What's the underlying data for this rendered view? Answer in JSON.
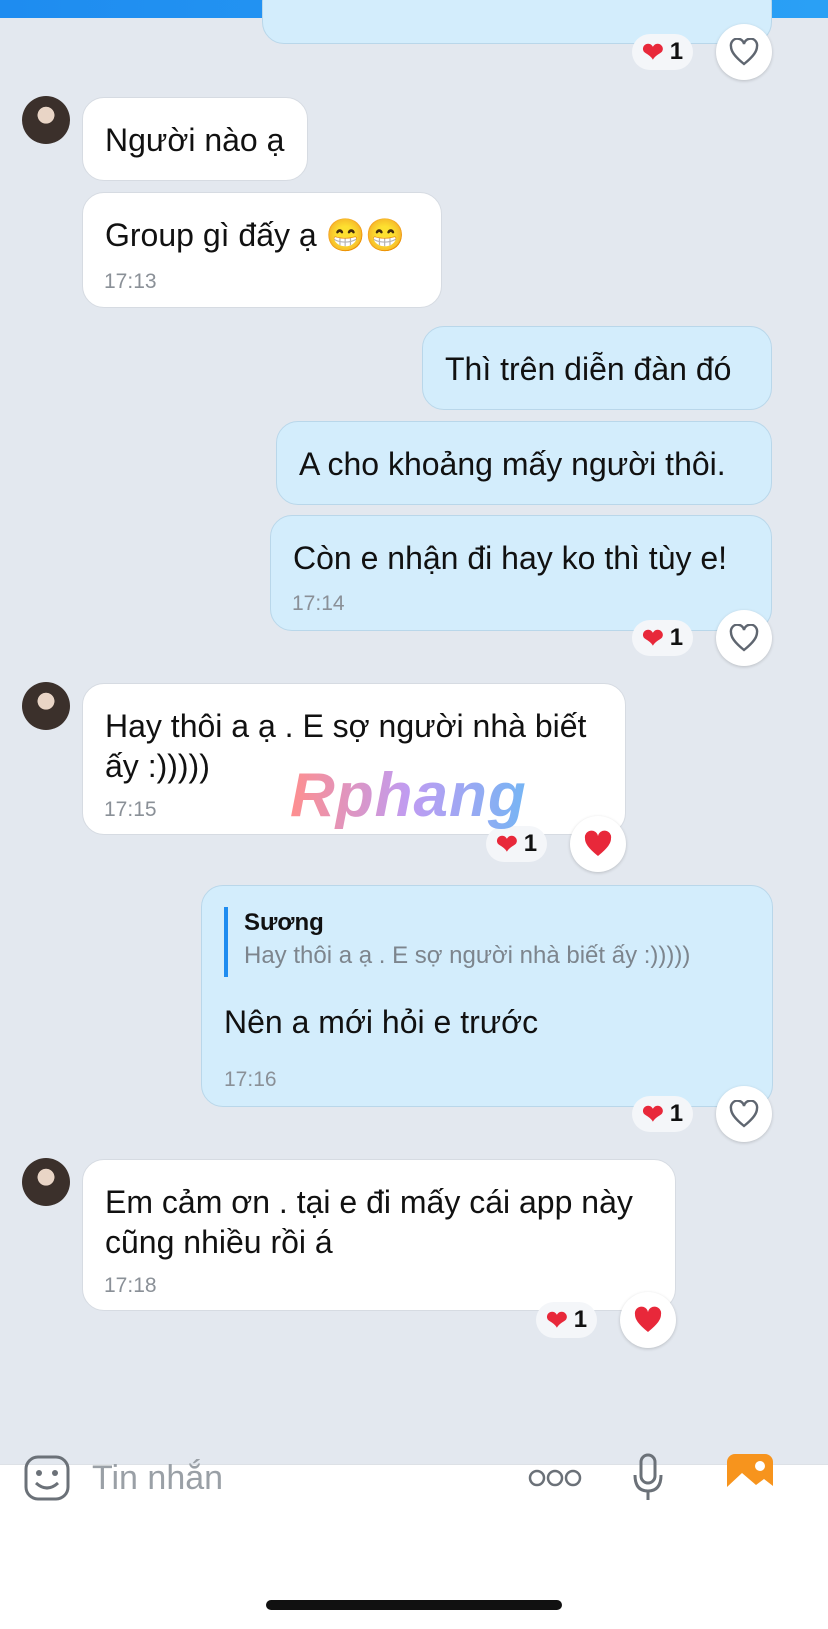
{
  "colors": {
    "background": "#e3e8ef",
    "incoming_bubble": "#ffffff",
    "outgoing_bubble": "#d3edfc",
    "accent": "#1e8cf0",
    "heart": "#e8283a",
    "image_button": "#f7941d"
  },
  "messages": [
    {
      "id": "m1",
      "side": "incoming",
      "text": "Người nào ạ"
    },
    {
      "id": "m2",
      "side": "incoming",
      "text": "Group gì đấy ạ 😁😁",
      "time": "17:13"
    },
    {
      "id": "m3",
      "side": "outgoing",
      "text": "Thì trên diễn đàn đó"
    },
    {
      "id": "m4",
      "side": "outgoing",
      "text": "A cho khoảng mấy người thôi."
    },
    {
      "id": "m5",
      "side": "outgoing",
      "text": "Còn e nhận đi hay ko thì tùy e!",
      "time": "17:14",
      "reaction_count": "1"
    },
    {
      "id": "m6",
      "side": "incoming",
      "text": "Hay thôi a ạ . E sợ người nhà biết ấy :)))))",
      "time": "17:15",
      "reaction_count": "1"
    },
    {
      "id": "m7",
      "side": "outgoing",
      "quote_author": "Sương",
      "quote_text": "Hay thôi a ạ . E sợ người nhà biết ấy :)))))",
      "text": "Nên a mới hỏi e trước",
      "time": "17:16",
      "reaction_count": "1"
    },
    {
      "id": "m8",
      "side": "incoming",
      "text": "Em cảm ơn . tại e đi mấy cái app này cũng nhiều rồi á",
      "time": "17:18",
      "reaction_count": "1"
    }
  ],
  "top_reaction_count": "1",
  "watermark": "Rphang",
  "input": {
    "placeholder": "Tin nhắn",
    "icons": [
      "sticker-icon",
      "more-icon",
      "microphone-icon",
      "image-icon"
    ]
  }
}
